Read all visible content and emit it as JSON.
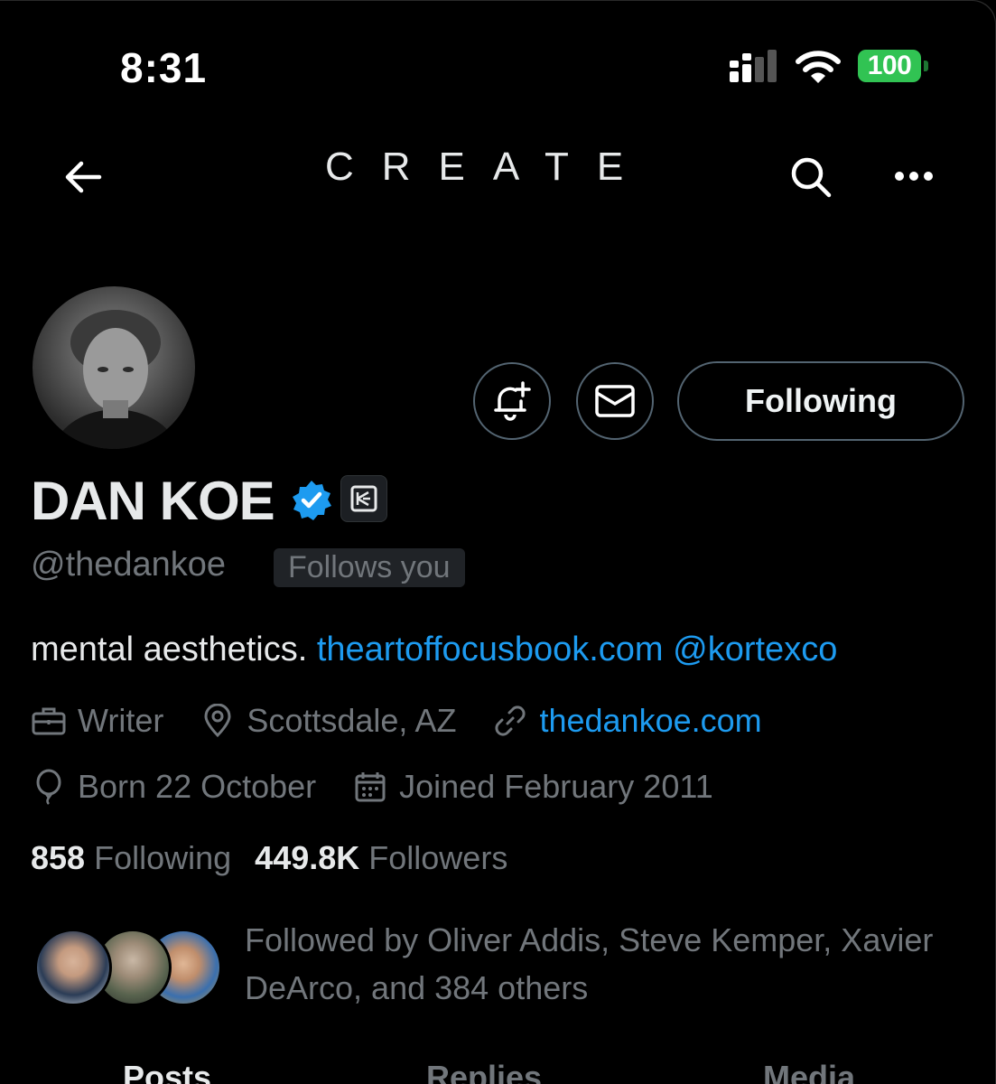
{
  "status_bar": {
    "time": "8:31",
    "battery": "100"
  },
  "nav": {
    "title": "CREATE"
  },
  "profile": {
    "display_name": "DAN KOE",
    "handle": "@thedankoe",
    "follows_you": "Follows you",
    "following_button": "Following",
    "bio_text": "mental aesthetics.",
    "bio_link": "theartoffocusbook.com",
    "bio_mention": "@kortexco",
    "profession": "Writer",
    "location": "Scottsdale, AZ",
    "website": "thedankoe.com",
    "birthday": "Born 22 October",
    "joined": "Joined February 2011",
    "following_count": "858",
    "following_label": "Following",
    "followers_count": "449.8K",
    "followers_label": "Followers",
    "followed_by": "Followed by Oliver Addis, Steve Kemper, Xavier DeArco, and 384 others"
  },
  "tabs": [
    "Posts",
    "Replies",
    "Media"
  ],
  "colors": {
    "accent": "#1d9bf0",
    "muted": "#71767b",
    "battery": "#31c353"
  },
  "icons": [
    "back-arrow-icon",
    "search-icon",
    "more-icon",
    "bell-plus-icon",
    "envelope-icon",
    "verified-badge-icon",
    "affiliate-badge-icon",
    "briefcase-icon",
    "location-pin-icon",
    "link-icon",
    "balloon-icon",
    "calendar-icon"
  ]
}
